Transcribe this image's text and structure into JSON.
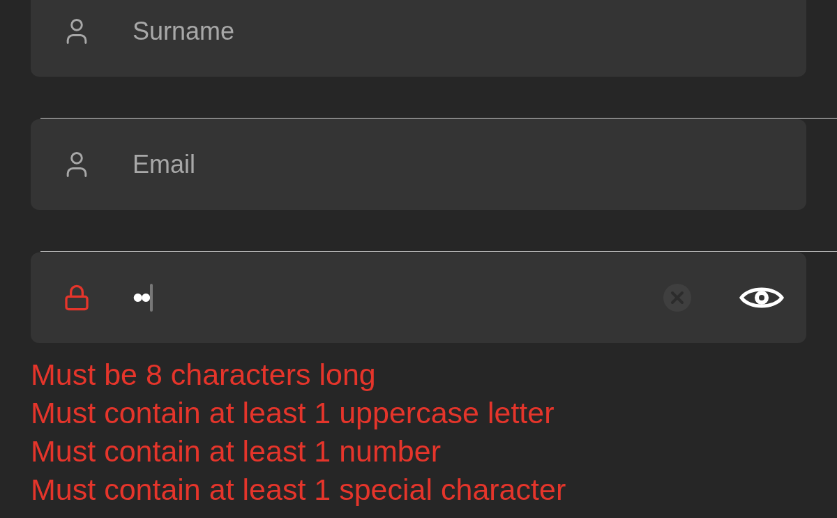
{
  "fields": [
    {
      "kind": "text",
      "placeholder": "Surname",
      "invalid": false
    },
    {
      "kind": "text",
      "placeholder": "Email",
      "invalid": false
    },
    {
      "kind": "password",
      "value": "••",
      "invalid": true,
      "focused": true
    }
  ],
  "errors": [
    "Must be 8 characters long",
    "Must contain at least 1 uppercase letter",
    "Must contain at least 1 number",
    "Must contain at least 1 special character"
  ]
}
